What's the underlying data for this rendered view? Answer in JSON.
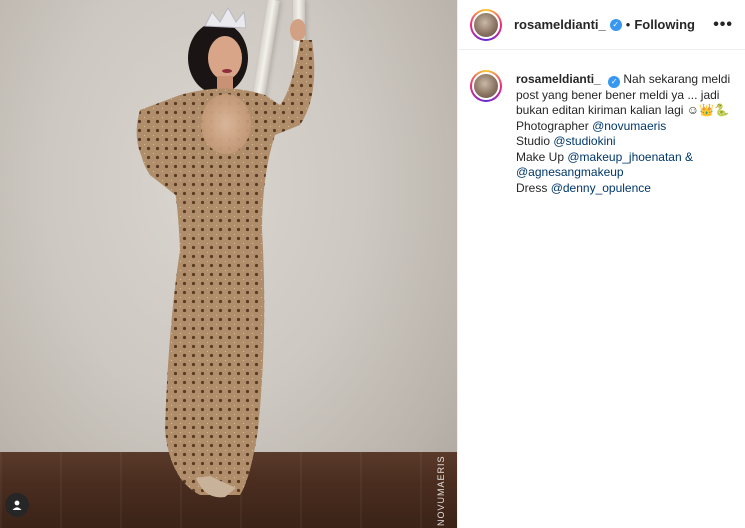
{
  "post": {
    "username": "rosameldianti_",
    "follow_state": "Following",
    "separator": "•",
    "more_label": "•••",
    "photo_watermark": "NOVUMAERIS"
  },
  "caption": {
    "username": "rosameldianti_",
    "text": "Nah sekarang meldi post yang bener bener meldi ya ... jadi bukan editan kiriman kalian lagi ☺👑🐍",
    "credits": [
      {
        "label": "Photographer",
        "handle": "@novumaeris"
      },
      {
        "label": "Studio",
        "handle": "@studiokini"
      },
      {
        "label": "Make Up",
        "handle": "@makeup_jhoenatan &"
      },
      {
        "label": "",
        "handle": "@agnesangmakeup"
      },
      {
        "label": "Dress",
        "handle": "@denny_opulence"
      }
    ]
  },
  "colors": {
    "verified_badge": "#3897f0",
    "mention": "#00376b",
    "text": "#262626"
  }
}
